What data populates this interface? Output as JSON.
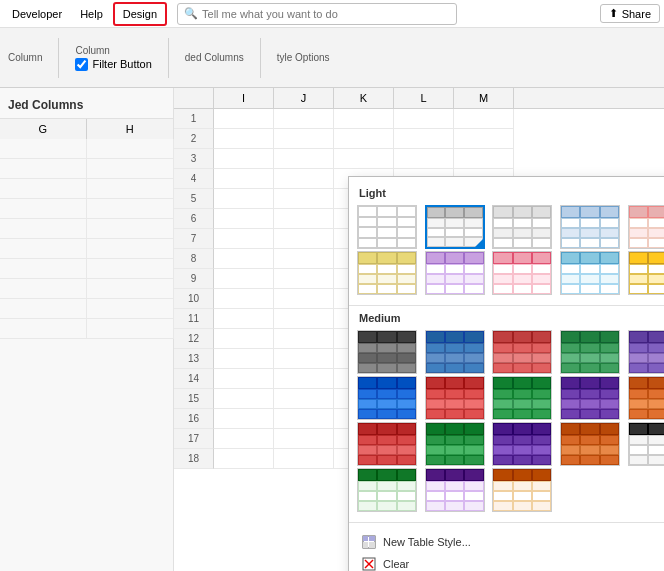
{
  "menubar": {
    "items": [
      "Developer",
      "Help",
      "Design"
    ],
    "active_item": "Design",
    "search_placeholder": "Tell me what you want to do",
    "share_label": "Share"
  },
  "ribbon": {
    "groups": [
      {
        "label": "Column",
        "items": []
      },
      {
        "label": "Column",
        "checkbox_label": "Filter Button",
        "checked": true
      },
      {
        "label": "ded Columns",
        "items": []
      },
      {
        "label": "tyle Options",
        "items": []
      }
    ]
  },
  "left_panel": {
    "title": "Jed Columns",
    "col_g": "G",
    "col_h": "H"
  },
  "dropdown": {
    "sections": [
      {
        "label": "Light",
        "styles": [
          {
            "id": "l0",
            "header_color": "none",
            "alt_color": "none",
            "border": "#ccc"
          },
          {
            "id": "l1",
            "header_color": "#c6c6c6",
            "alt_color": "#ffffff",
            "border": "#999",
            "selected": true
          },
          {
            "id": "l2",
            "header_color": "#eeeeee",
            "alt_color": "#ffffff",
            "border": "#ccc"
          },
          {
            "id": "l3",
            "header_color": "#dde8f5",
            "alt_color": "#eef4fb",
            "border": "#6fa0cc"
          },
          {
            "id": "l4",
            "header_color": "#f8d7d7",
            "alt_color": "#fdeaea",
            "border": "#e88"
          },
          {
            "id": "l5",
            "header_color": "#d8efd8",
            "alt_color": "#edf8ed",
            "border": "#7bc"
          },
          {
            "id": "l6",
            "header_color": "#d5e8d4",
            "alt_color": "#eaf4e9",
            "border": "#5a9"
          },
          {
            "id": "l7",
            "header_color": "#d0e4f5",
            "alt_color": "#e8f2fb",
            "border": "#5a9"
          },
          {
            "id": "l8",
            "header_color": "#dde8f5",
            "alt_color": "#eef4fb",
            "border": "#6fa0cc"
          },
          {
            "id": "l9",
            "header_color": "#f8e5d0",
            "alt_color": "#fdf2e8",
            "border": "#e0a060"
          },
          {
            "id": "l10",
            "header_color": "#f5f0d0",
            "alt_color": "#faf8e8",
            "border": "#c8b860"
          },
          {
            "id": "l11",
            "header_color": "#e8d5f5",
            "alt_color": "#f4eafb",
            "border": "#a06ec8"
          },
          {
            "id": "l12",
            "header_color": "#ffd8e0",
            "alt_color": "#ffe8ee",
            "border": "#e05070"
          },
          {
            "id": "l13",
            "header_color": "#d8f0f8",
            "alt_color": "#ecf8fc",
            "border": "#50a0c8"
          },
          {
            "id": "l14",
            "header_color": "#ffd880",
            "alt_color": "#fff0bb",
            "border": "#c89820"
          },
          {
            "id": "l15",
            "header_color": "#ffe0a0",
            "alt_color": "#fff4d0",
            "border": "#d0a020"
          },
          {
            "id": "l16",
            "header_color": "#ffe8b0",
            "alt_color": "#fff8e0",
            "border": "#c8a030"
          },
          {
            "id": "l17",
            "header_color": "#ffd060",
            "alt_color": "#ffec99",
            "border": "#c89000"
          },
          {
            "id": "l18",
            "header_color": "#ffcc44",
            "alt_color": "#ffee99",
            "border": "#c89000"
          }
        ],
        "rows_count": 3
      },
      {
        "label": "Medium",
        "styles": [
          {
            "id": "m0",
            "header_color": "#404040",
            "alt_color": "#606060",
            "border": "#222"
          },
          {
            "id": "m1",
            "header_color": "#2060a0",
            "alt_color": "#4080c0",
            "border": "#1040a0"
          },
          {
            "id": "m2",
            "header_color": "#c04040",
            "alt_color": "#e06060",
            "border": "#a02020"
          },
          {
            "id": "m3",
            "header_color": "#208040",
            "alt_color": "#40a060",
            "border": "#106030"
          },
          {
            "id": "m4",
            "header_color": "#6040a0",
            "alt_color": "#8060c0",
            "border": "#402080"
          },
          {
            "id": "m5",
            "header_color": "#c06020",
            "alt_color": "#e08040",
            "border": "#a04010"
          },
          {
            "id": "m6",
            "header_color": "#606060",
            "alt_color": "#888888",
            "border": "#404040"
          },
          {
            "id": "m7",
            "header_color": "#1050b0",
            "alt_color": "#3070d0",
            "border": "#0030a0"
          },
          {
            "id": "m8",
            "header_color": "#b03030",
            "alt_color": "#d05050",
            "border": "#901010"
          },
          {
            "id": "m9",
            "header_color": "#108030",
            "alt_color": "#30a050",
            "border": "#006020"
          },
          {
            "id": "m10",
            "header_color": "#502080",
            "alt_color": "#7040a0",
            "border": "#301060"
          },
          {
            "id": "m11",
            "header_color": "#b05010",
            "alt_color": "#d07030",
            "border": "#903000"
          },
          {
            "id": "m12",
            "header_color": "#202020",
            "alt_color": "#404040",
            "border": "#000000"
          },
          {
            "id": "m13",
            "header_color": "#0040c0",
            "alt_color": "#2060e0",
            "border": "#0020a0"
          },
          {
            "id": "m14",
            "header_color": "#a02020",
            "alt_color": "#c04040",
            "border": "#800000"
          },
          {
            "id": "m15",
            "header_color": "#006020",
            "alt_color": "#208040",
            "border": "#004010"
          },
          {
            "id": "m16",
            "header_color": "#400070",
            "alt_color": "#602090",
            "border": "#200050"
          },
          {
            "id": "m17",
            "header_color": "#a04000",
            "alt_color": "#c06020",
            "border": "#803000"
          },
          {
            "id": "m18",
            "header_color": "#202020",
            "alt_color": "#505050",
            "border": "#000"
          },
          {
            "id": "m19",
            "header_color": "#0050c0",
            "alt_color": "#2070e0",
            "border": "#0030a0"
          },
          {
            "id": "m20",
            "header_color": "#c03030",
            "alt_color": "#e05050",
            "border": "#a01010"
          },
          {
            "id": "m21",
            "header_color": "#108030",
            "alt_color": "#30a050",
            "border": "#006020"
          },
          {
            "id": "m22",
            "header_color": "#502090",
            "alt_color": "#7040b0",
            "border": "#301070"
          },
          {
            "id": "m23",
            "header_color": "#c05010",
            "alt_color": "#e07030",
            "border": "#a03000"
          },
          {
            "id": "m24",
            "header_color": "#181818",
            "alt_color": "#383838",
            "border": "#000"
          },
          {
            "id": "m25",
            "header_color": "#0048b8",
            "alt_color": "#2068d8",
            "border": "#0028a0"
          },
          {
            "id": "m26",
            "header_color": "#b82828",
            "alt_color": "#d84848",
            "border": "#981010"
          },
          {
            "id": "m27",
            "header_color": "#0a7828",
            "alt_color": "#2a9848",
            "border": "#085818"
          },
          {
            "id": "m28",
            "header_color": "#481888",
            "alt_color": "#6838a8",
            "border": "#280068"
          },
          {
            "id": "m29",
            "header_color": "#b84808",
            "alt_color": "#d86828",
            "border": "#983000"
          }
        ]
      }
    ],
    "bottom_actions": [
      {
        "label": "New Table Style...",
        "icon": "table-icon"
      },
      {
        "label": "Clear",
        "icon": "clear-icon"
      }
    ]
  }
}
